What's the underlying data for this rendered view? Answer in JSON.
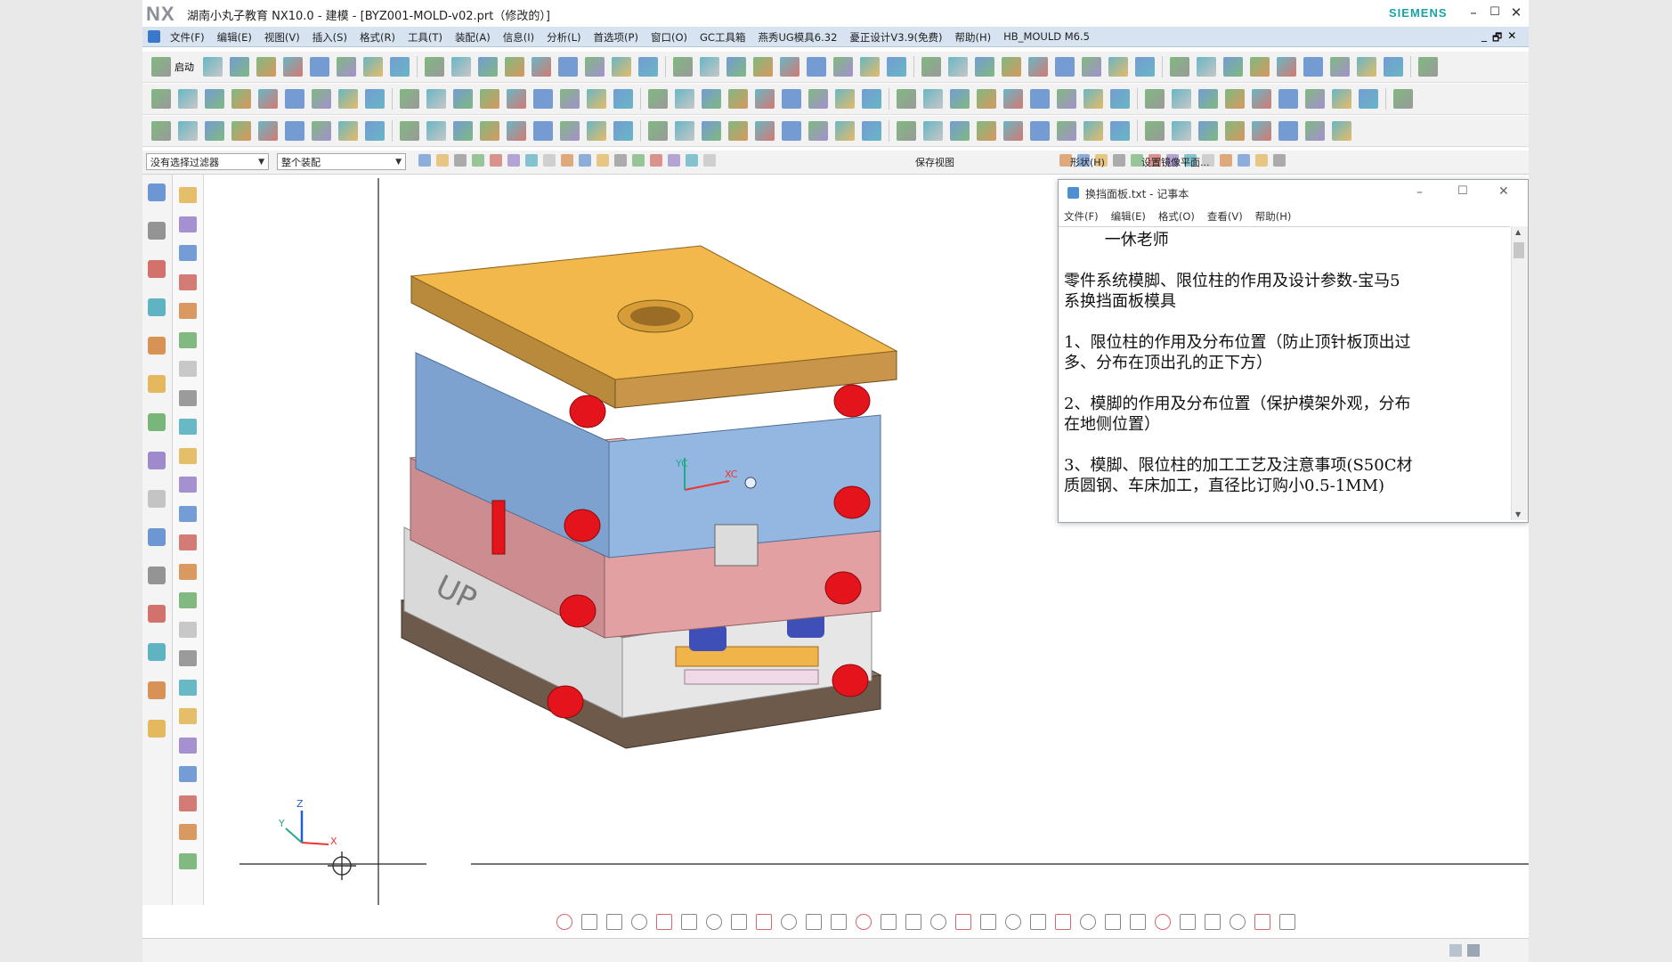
{
  "window": {
    "logo": "NX",
    "title": "湖南小丸子教育 NX10.0 - 建模 - [BYZ001-MOLD-v02.prt（修改的）]",
    "brand": "SIEMENS",
    "minimize": "–",
    "maximize": "☐",
    "close": "✕"
  },
  "menubar": {
    "items": [
      "文件(F)",
      "编辑(E)",
      "视图(V)",
      "插入(S)",
      "格式(R)",
      "工具(T)",
      "装配(A)",
      "信息(I)",
      "分析(L)",
      "首选项(P)",
      "窗口(O)",
      "GC工具箱",
      "燕秀UG模具6.32",
      "憂正设计V3.9(免费)",
      "帮助(H)",
      "HB_MOULD M6.5"
    ],
    "doc_controls": [
      "_",
      "🗗",
      "✕"
    ]
  },
  "toolbar": {
    "start_label": "启动",
    "save_view_label": "保存视图",
    "shape_label": "形状(H)",
    "mirror_plane_label": "设置镜像平面..."
  },
  "filterbar": {
    "selection_filter": "没有选择过滤器",
    "assembly_scope": "整个装配"
  },
  "viewport": {
    "triad_z": "Z",
    "triad_x": "X",
    "triad_y": "Y",
    "wcs_xc": "XC",
    "wcs_yc": "YC",
    "up_mark": "UP"
  },
  "notepad": {
    "title": "换挡面板.txt - 记事本",
    "menu": [
      "文件(F)",
      "编辑(E)",
      "格式(O)",
      "查看(V)",
      "帮助(H)"
    ],
    "lines": [
      "        一休老师",
      "",
      "零件系统模脚、限位柱的作用及设计参数-宝马5",
      "系换挡面板模具",
      "",
      "1、限位柱的作用及分布位置（防止顶针板顶出过",
      "多、分布在顶出孔的正下方）",
      "",
      "2、模脚的作用及分布位置（保护模架外观，分布",
      "在地侧位置）",
      "",
      "3、模脚、限位柱的加工工艺及注意事项(S50C材",
      "质圆钢、车床加工，直径比订购小0.5-1MM)"
    ]
  },
  "colors": {
    "top_plate": "#f2b84b",
    "a_plate": "#8fb4de",
    "b_plate": "#e2a0a2",
    "stops": "#e3141b",
    "clamp_plate": "#6d5a4b",
    "spacer": "#d9d9d9",
    "menubar": "#d7e3f0"
  }
}
